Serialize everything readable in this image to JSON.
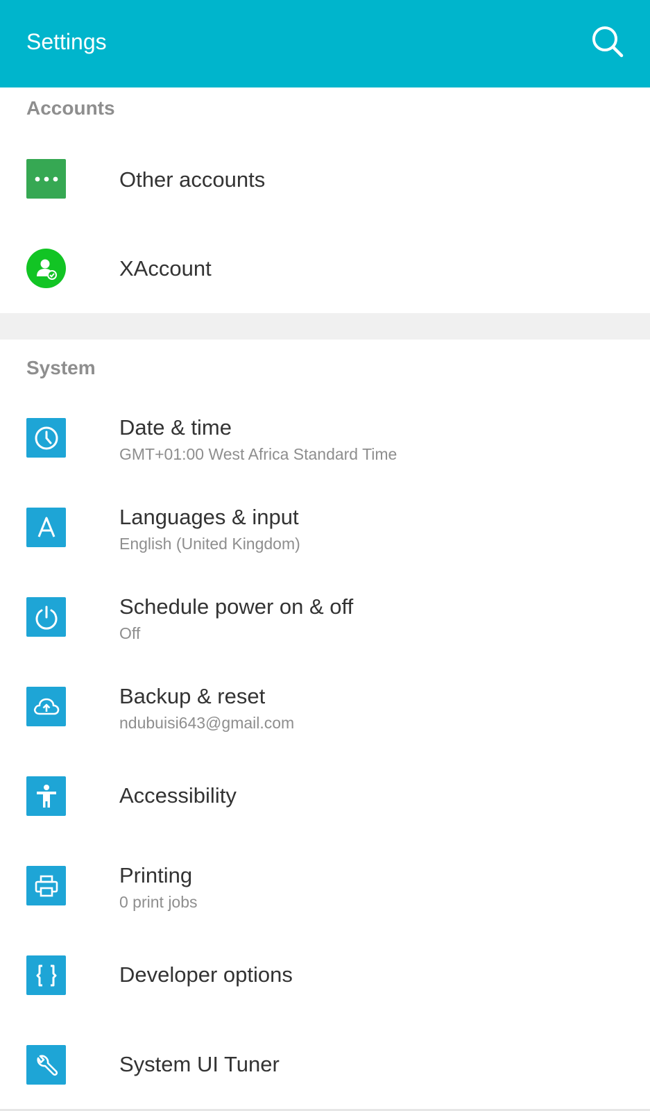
{
  "app": {
    "title": "Settings"
  },
  "colors": {
    "appbar": "#00b5cc",
    "icon_blue": "#1ea5d6",
    "icon_green": "#36a853",
    "account_green": "#12c424"
  },
  "accounts_section": {
    "header": "Accounts",
    "items": [
      {
        "label": "Other accounts",
        "icon": "more-dots-icon"
      },
      {
        "label": "XAccount",
        "icon": "user-verified-icon"
      }
    ]
  },
  "system_section": {
    "header": "System",
    "items": [
      {
        "label": "Date & time",
        "sub": "GMT+01:00 West Africa Standard Time",
        "icon": "clock-icon"
      },
      {
        "label": "Languages & input",
        "sub": "English (United Kingdom)",
        "icon": "language-a-icon"
      },
      {
        "label": "Schedule power on & off",
        "sub": "Off",
        "icon": "power-icon"
      },
      {
        "label": "Backup & reset",
        "sub": "ndubuisi643@gmail.com",
        "icon": "cloud-upload-icon"
      },
      {
        "label": "Accessibility",
        "icon": "accessibility-icon"
      },
      {
        "label": "Printing",
        "sub": "0 print jobs",
        "icon": "printer-icon"
      },
      {
        "label": "Developer options",
        "icon": "braces-icon"
      },
      {
        "label": "System UI Tuner",
        "icon": "wrench-icon"
      }
    ]
  }
}
